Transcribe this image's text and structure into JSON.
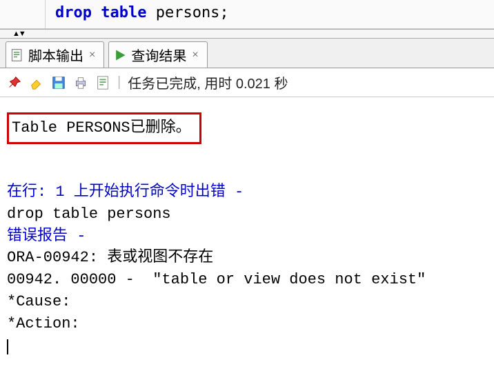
{
  "editor": {
    "kw1": "drop",
    "kw2": "table",
    "rest": " persons;"
  },
  "tabs": [
    {
      "label": "脚本输出"
    },
    {
      "label": "查询结果"
    }
  ],
  "toolbar": {
    "status": "任务已完成, 用时 0.021 秒"
  },
  "output": {
    "success_msg": "Table PERSONS已删除。",
    "err_line1": "在行: 1 上开始执行命令时出错 -",
    "stmt": "drop table persons",
    "err_report": "错误报告 -",
    "ora": "ORA-00942: 表或视图不存在",
    "code": "00942. 00000 -  \"table or view does not exist\"",
    "cause": "*Cause:",
    "action": "*Action:"
  }
}
